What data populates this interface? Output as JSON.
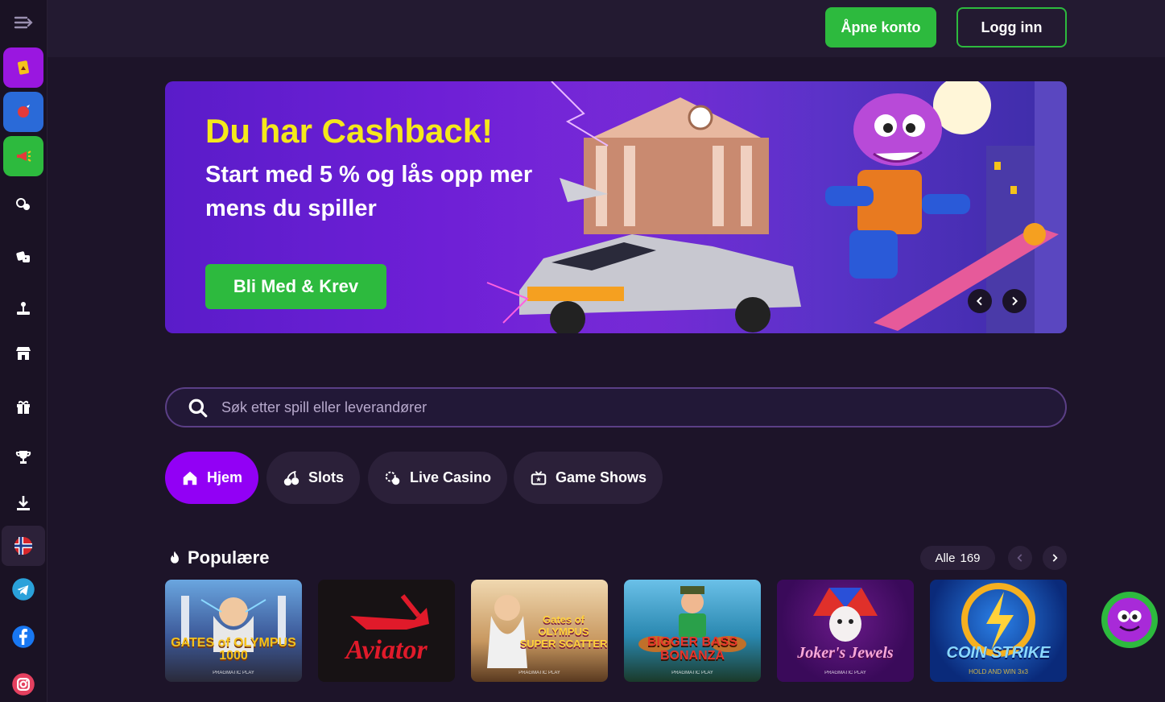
{
  "header": {
    "open_account": "Åpne konto",
    "login": "Logg inn"
  },
  "hero": {
    "title": "Du har Cashback!",
    "subtitle": "Start med 5 % og lås opp mer mens du spiller",
    "cta": "Bli Med & Krev"
  },
  "search": {
    "placeholder": "Søk etter spill eller leverandører"
  },
  "tabs": [
    {
      "label": "Hjem",
      "icon": "home-icon"
    },
    {
      "label": "Slots",
      "icon": "cherries-icon"
    },
    {
      "label": "Live Casino",
      "icon": "chips-icon"
    },
    {
      "label": "Game Shows",
      "icon": "tv-icon"
    }
  ],
  "section": {
    "title": "Populære",
    "all_label": "Alle",
    "all_count": "169"
  },
  "games": [
    {
      "title": "GATES of OLYMPUS 1000",
      "provider": "PRAGMATIC PLAY"
    },
    {
      "title": "Aviator",
      "provider": ""
    },
    {
      "title": "Gates of OLYMPUS SUPER SCATTER",
      "provider": "PRAGMATIC PLAY"
    },
    {
      "title": "BIGGER BASS BONANZA",
      "provider": "PRAGMATIC PLAY"
    },
    {
      "title": "Joker's Jewels",
      "provider": "PRAGMATIC PLAY"
    },
    {
      "title": "COIN STRIKE",
      "provider": "HOLD AND WIN 3x3"
    }
  ],
  "colors": {
    "accent_green": "#2dba3e",
    "accent_purple": "#9200f5",
    "hero_title": "#f5e81b",
    "bg": "#1d1429"
  }
}
